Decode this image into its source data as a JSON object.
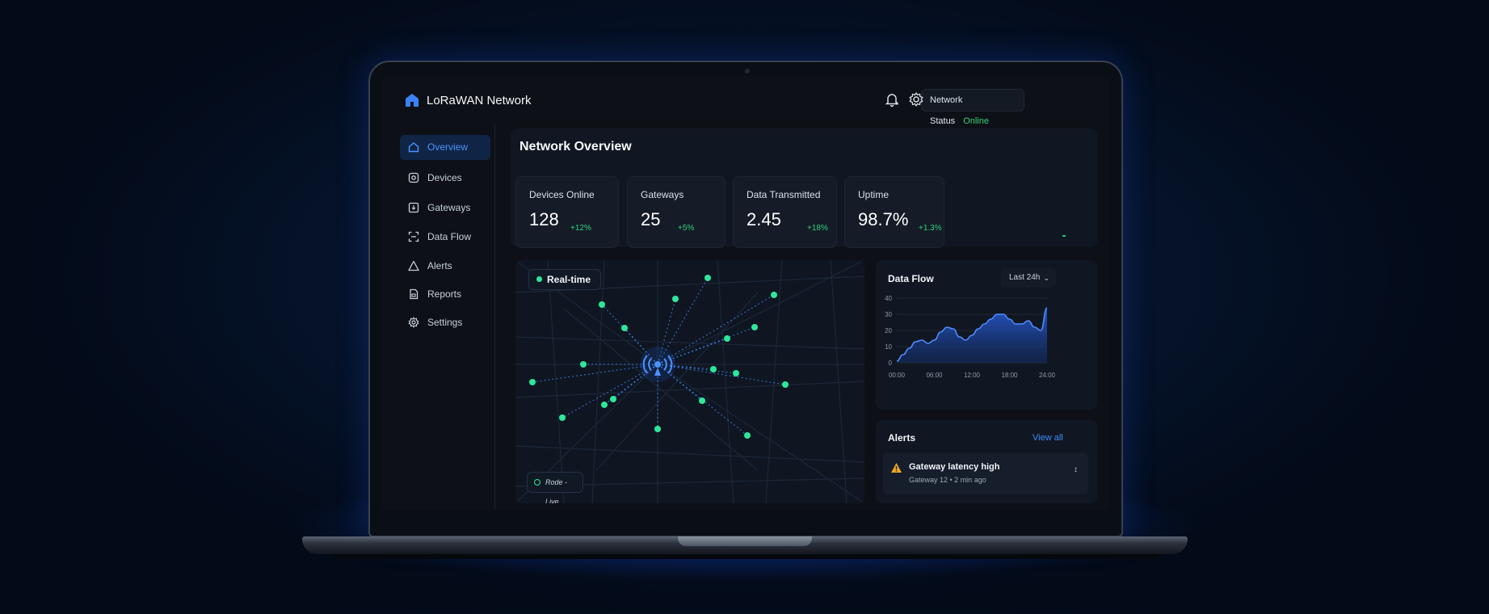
{
  "app": {
    "title": "LoRaWAN Network",
    "logo_icon": "home-icon"
  },
  "header": {
    "status_label": "Network Status",
    "status_value": "Online",
    "status_color": "#34d27b",
    "notifications_icon": "bell-icon",
    "settings_icon": "gear-icon"
  },
  "sidebar": {
    "items": [
      {
        "label": "Overview",
        "icon": "home-icon",
        "active": true
      },
      {
        "label": "Devices",
        "icon": "device-icon",
        "active": false
      },
      {
        "label": "Gateways",
        "icon": "gateway-icon",
        "active": false
      },
      {
        "label": "Data Flow",
        "icon": "scan-icon",
        "active": false
      },
      {
        "label": "Alerts",
        "icon": "warning-icon",
        "active": false
      },
      {
        "label": "Reports",
        "icon": "report-icon",
        "active": false
      },
      {
        "label": "Settings",
        "icon": "gear-icon",
        "active": false
      }
    ]
  },
  "overview": {
    "title": "Network Overview",
    "stats": [
      {
        "label": "Devices Online",
        "value": "128",
        "delta": "+12%"
      },
      {
        "label": "Gateways",
        "value": "25",
        "delta": "+5%"
      },
      {
        "label": "Data Transmitted",
        "value": "2.45",
        "delta": "+18%"
      },
      {
        "label": "Uptime",
        "value": "98.7%",
        "delta": "+1.3%"
      }
    ]
  },
  "map": {
    "realtime_label": "Real-time",
    "node_label": "Rode - Live",
    "gateway_icon": "antenna-icon",
    "node_color": "#2ee89a",
    "accent": "#2f7bff"
  },
  "data_flow": {
    "title": "Data Flow",
    "range": "Last 24h"
  },
  "chart_data": {
    "type": "area",
    "title": "Data Flow",
    "x_ticks": [
      "00:00",
      "06:00",
      "12:00",
      "18:00",
      "24:00"
    ],
    "y_ticks": [
      0,
      10,
      20,
      30,
      40
    ],
    "ylim": [
      0,
      40
    ],
    "xlim": [
      0,
      24
    ],
    "grid": true,
    "series": [
      {
        "x": [
          0,
          1,
          2,
          3,
          4,
          5,
          6,
          7,
          8,
          9,
          10,
          11,
          12,
          13,
          14,
          15,
          16,
          17,
          18,
          19,
          20,
          21,
          22,
          23,
          24
        ],
        "values": [
          1,
          5,
          9,
          13,
          14,
          12,
          14,
          19,
          22,
          21,
          16,
          14,
          17,
          21,
          24,
          27,
          30,
          30,
          27,
          24,
          24,
          26,
          22,
          20,
          34
        ]
      }
    ]
  },
  "alerts": {
    "title": "Alerts",
    "view_all": "View all",
    "items": [
      {
        "title": "Gateway latency high",
        "subtitle": "Gateway 12 • 2 min ago",
        "icon": "warning-icon",
        "color": "#f0a623"
      }
    ]
  }
}
